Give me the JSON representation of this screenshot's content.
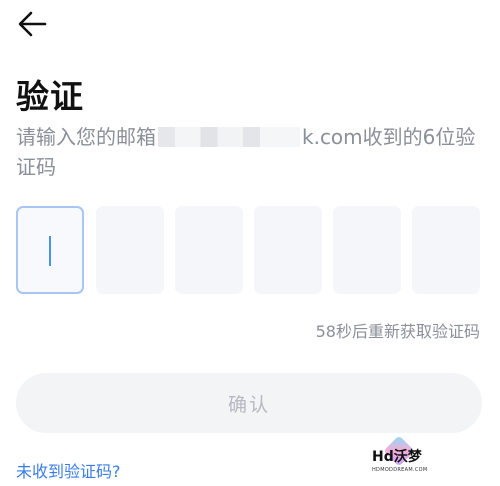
{
  "nav": {
    "back_icon": "arrow-left-icon"
  },
  "page": {
    "title": "验证",
    "desc_prefix": "请输入您的邮箱",
    "desc_suffix": "k.com收到的6位验证码"
  },
  "code": {
    "length": 6,
    "digits": [
      "",
      "",
      "",
      "",
      "",
      ""
    ],
    "active_index": 0
  },
  "resend_text": "58秒后重新获取验证码",
  "confirm_label": "确认",
  "help_link": "未收到验证码?",
  "watermark": {
    "text": "Hd沃梦",
    "sub": "HDMODDREAM.COM"
  },
  "colors": {
    "accent": "#3b7de6",
    "active_border": "#a9c6f2",
    "muted": "#8a8f99"
  }
}
